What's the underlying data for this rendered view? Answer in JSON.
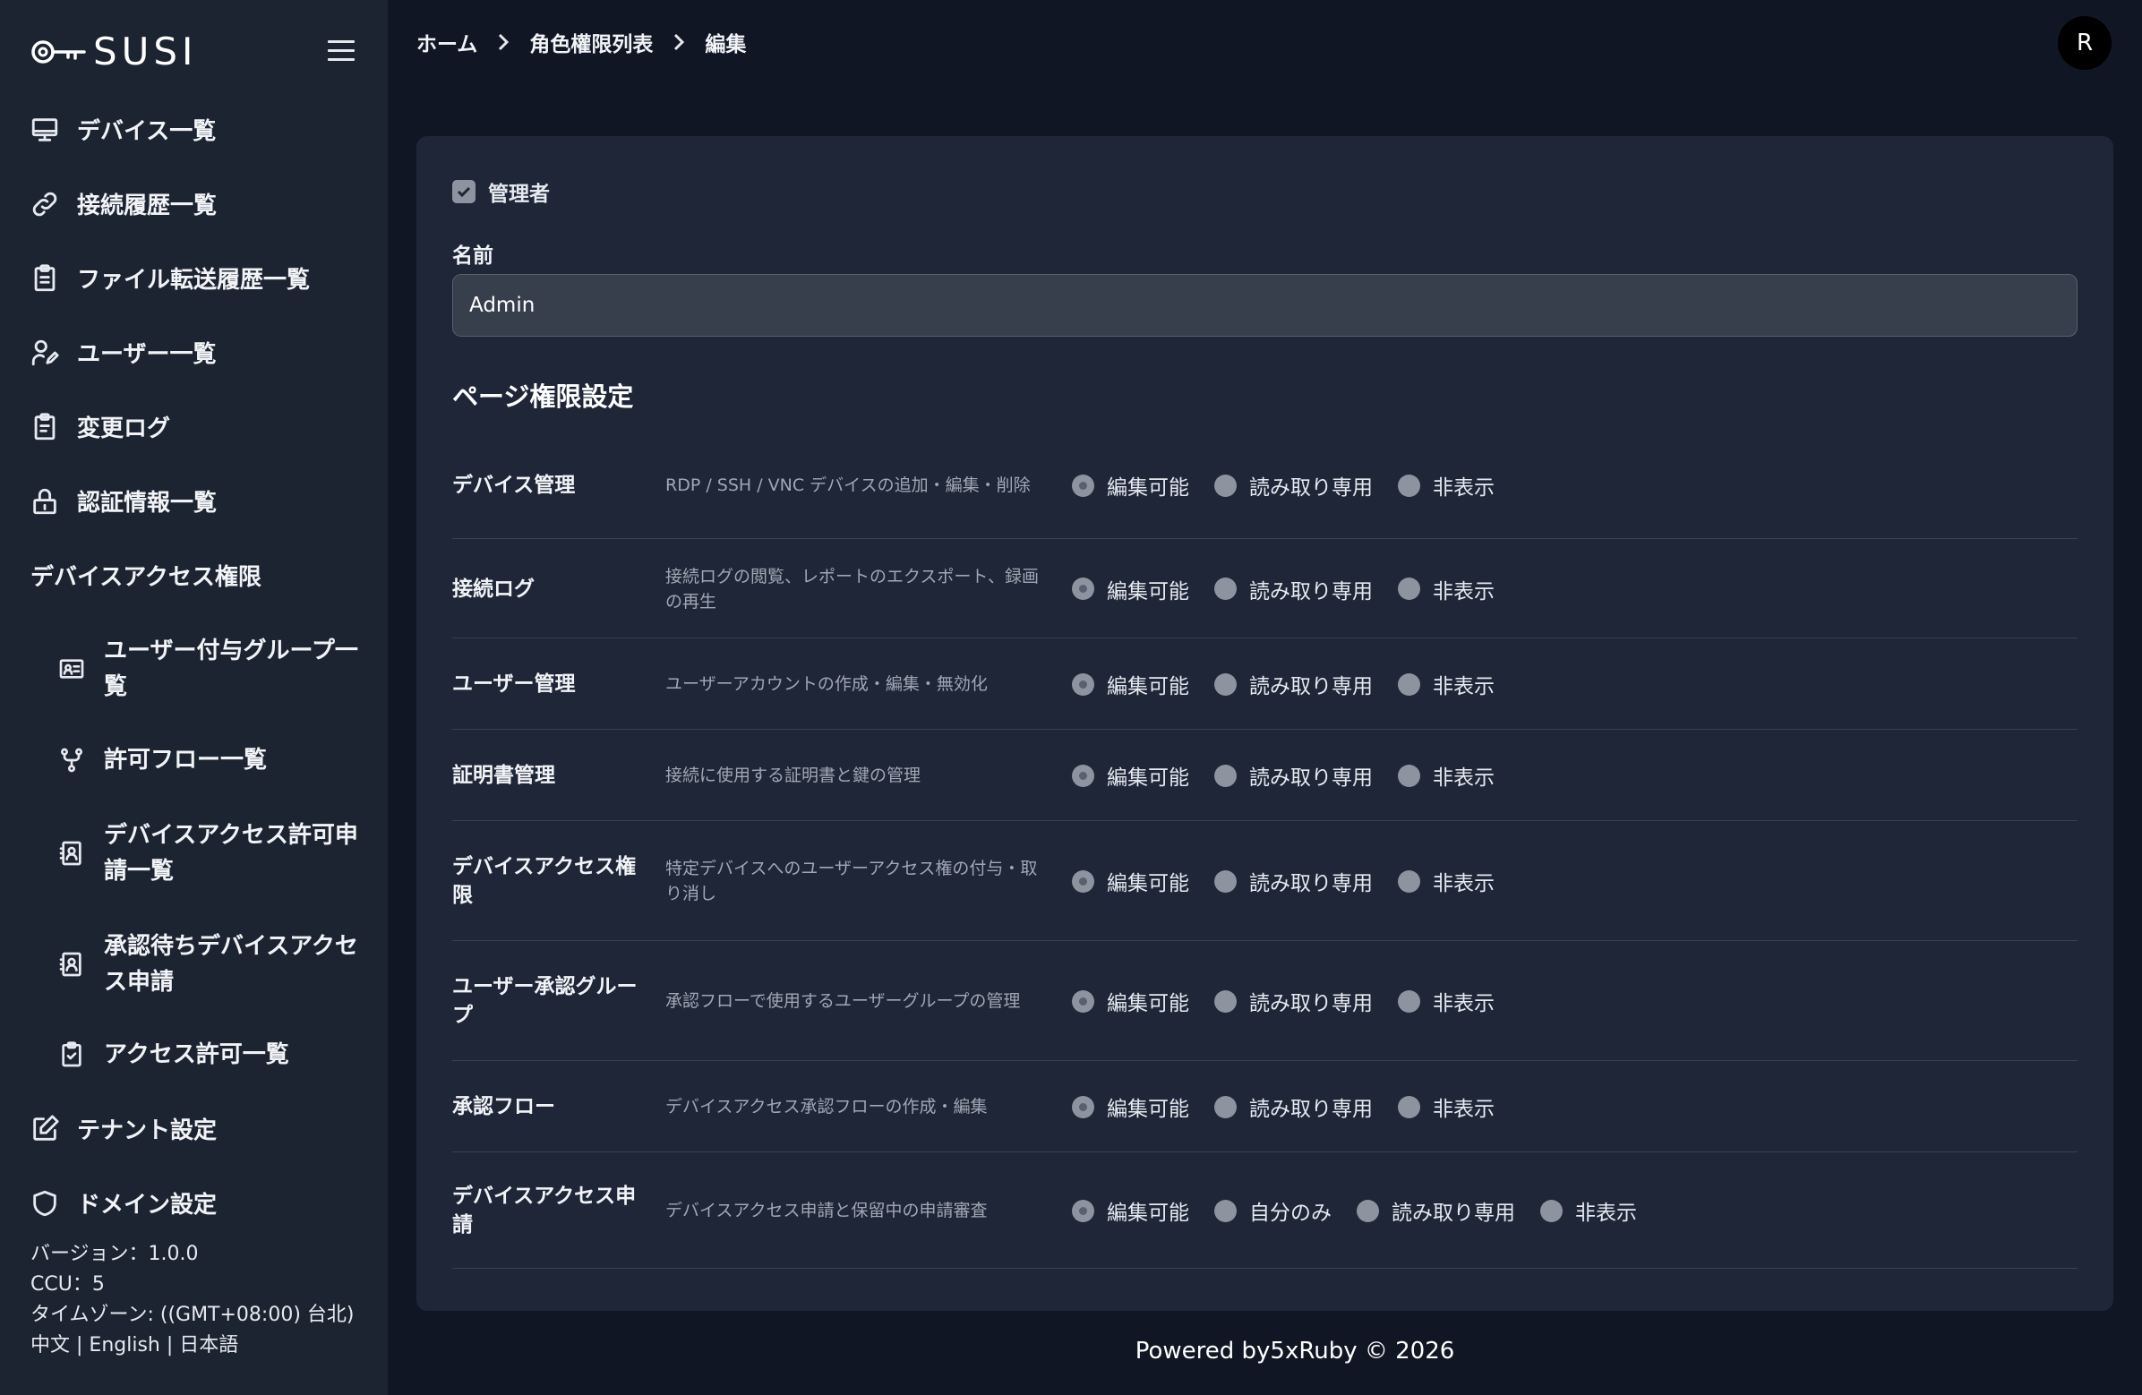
{
  "brand": {
    "name": "SUSI"
  },
  "sidebar": {
    "items": [
      {
        "label": "デバイス一覧",
        "icon": "monitor-icon"
      },
      {
        "label": "接続履歴一覧",
        "icon": "link-icon"
      },
      {
        "label": "ファイル転送履歴一覧",
        "icon": "clipboard-list-icon"
      },
      {
        "label": "ユーザー一覧",
        "icon": "user-edit-icon"
      },
      {
        "label": "変更ログ",
        "icon": "clipboard-icon"
      },
      {
        "label": "認証情報一覧",
        "icon": "lock-icon"
      }
    ],
    "section_title": "デバイスアクセス権限",
    "sub_items": [
      {
        "label": "ユーザー付与グループ一覧",
        "icon": "id-card-icon"
      },
      {
        "label": "許可フロー一覧",
        "icon": "git-branch-icon"
      },
      {
        "label": "デバイスアクセス許可申請一覧",
        "icon": "contact-book-icon"
      },
      {
        "label": "承認待ちデバイスアクセス申請",
        "icon": "contact-book-icon"
      },
      {
        "label": "アクセス許可一覧",
        "icon": "clipboard-check-icon"
      }
    ],
    "bottom_items": [
      {
        "label": "テナント設定",
        "icon": "edit-icon"
      },
      {
        "label": "ドメイン設定",
        "icon": "shield-icon"
      }
    ],
    "footer": {
      "version": "バージョン：1.0.0",
      "ccu": "CCU：5",
      "timezone": "タイムゾーン: ((GMT+08:00) 台北)",
      "lang_zh": "中文",
      "lang_en": "English",
      "lang_ja": "日本語",
      "lang_sep": " | "
    }
  },
  "header": {
    "breadcrumb": [
      "ホーム",
      "角色權限列表",
      "編集"
    ],
    "avatar_initial": "R"
  },
  "form": {
    "admin_label": "管理者",
    "admin_checked": true,
    "name_label": "名前",
    "name_value": "Admin",
    "section_title": "ページ権限設定",
    "permissions": [
      {
        "name": "デバイス管理",
        "desc": "RDP / SSH / VNC デバイスの追加・編集・削除",
        "options": [
          "編集可能",
          "読み取り専用",
          "非表示"
        ],
        "selected": 0
      },
      {
        "name": "接続ログ",
        "desc": "接続ログの閲覧、レポートのエクスポート、録画の再生",
        "options": [
          "編集可能",
          "読み取り専用",
          "非表示"
        ],
        "selected": 0
      },
      {
        "name": "ユーザー管理",
        "desc": "ユーザーアカウントの作成・編集・無効化",
        "options": [
          "編集可能",
          "読み取り専用",
          "非表示"
        ],
        "selected": 0
      },
      {
        "name": "証明書管理",
        "desc": "接続に使用する証明書と鍵の管理",
        "options": [
          "編集可能",
          "読み取り専用",
          "非表示"
        ],
        "selected": 0
      },
      {
        "name": "デバイスアクセス権限",
        "desc": "特定デバイスへのユーザーアクセス権の付与・取り消し",
        "options": [
          "編集可能",
          "読み取り専用",
          "非表示"
        ],
        "selected": 0
      },
      {
        "name": "ユーザー承認グループ",
        "desc": "承認フローで使用するユーザーグループの管理",
        "options": [
          "編集可能",
          "読み取り専用",
          "非表示"
        ],
        "selected": 0
      },
      {
        "name": "承認フロー",
        "desc": "デバイスアクセス承認フローの作成・編集",
        "options": [
          "編集可能",
          "読み取り専用",
          "非表示"
        ],
        "selected": 0
      },
      {
        "name": "デバイスアクセス申請",
        "desc": "デバイスアクセス申請と保留中の申請審査",
        "options": [
          "編集可能",
          "自分のみ",
          "読み取り専用",
          "非表示"
        ],
        "selected": 0
      }
    ]
  },
  "footer": {
    "powered_by": "Powered by5xRuby © 2026"
  }
}
